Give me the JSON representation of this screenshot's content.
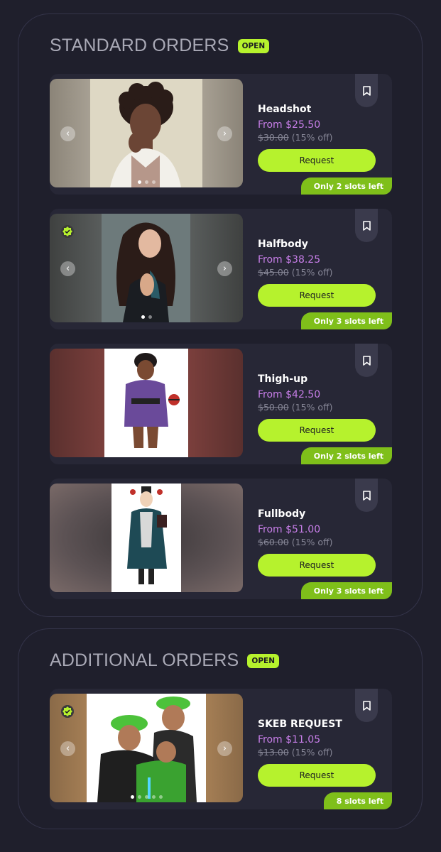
{
  "sections": [
    {
      "title": "STANDARD ORDERS",
      "badge": "OPEN",
      "cards": [
        {
          "name": "Headshot",
          "price": "From $25.50",
          "orig": "$30.00",
          "discount": "(15% off)",
          "button": "Request",
          "slots": "Only 2 slots left"
        },
        {
          "name": "Halfbody",
          "price": "From $38.25",
          "orig": "$45.00",
          "discount": "(15% off)",
          "button": "Request",
          "slots": "Only 3 slots left"
        },
        {
          "name": "Thigh-up",
          "price": "From $42.50",
          "orig": "$50.00",
          "discount": "(15% off)",
          "button": "Request",
          "slots": "Only 2 slots left"
        },
        {
          "name": "Fullbody",
          "price": "From $51.00",
          "orig": "$60.00",
          "discount": "(15% off)",
          "button": "Request",
          "slots": "Only 3 slots left"
        }
      ]
    },
    {
      "title": "ADDITIONAL ORDERS",
      "badge": "OPEN",
      "cards": [
        {
          "name": "SKEB REQUEST",
          "price": "From $11.05",
          "orig": "$13.00",
          "discount": "(15% off)",
          "button": "Request",
          "slots": "8 slots left"
        }
      ]
    }
  ],
  "icons": {
    "carousel_prev": "chevron-left-icon",
    "carousel_next": "chevron-right-icon",
    "bookmark": "bookmark-icon",
    "verified": "verified-check-icon"
  },
  "colors": {
    "accent": "#b6f22d",
    "price": "#c77ee8",
    "slots_badge": "#7fbf1a",
    "background": "#1f1f2c",
    "card": "#272736"
  }
}
